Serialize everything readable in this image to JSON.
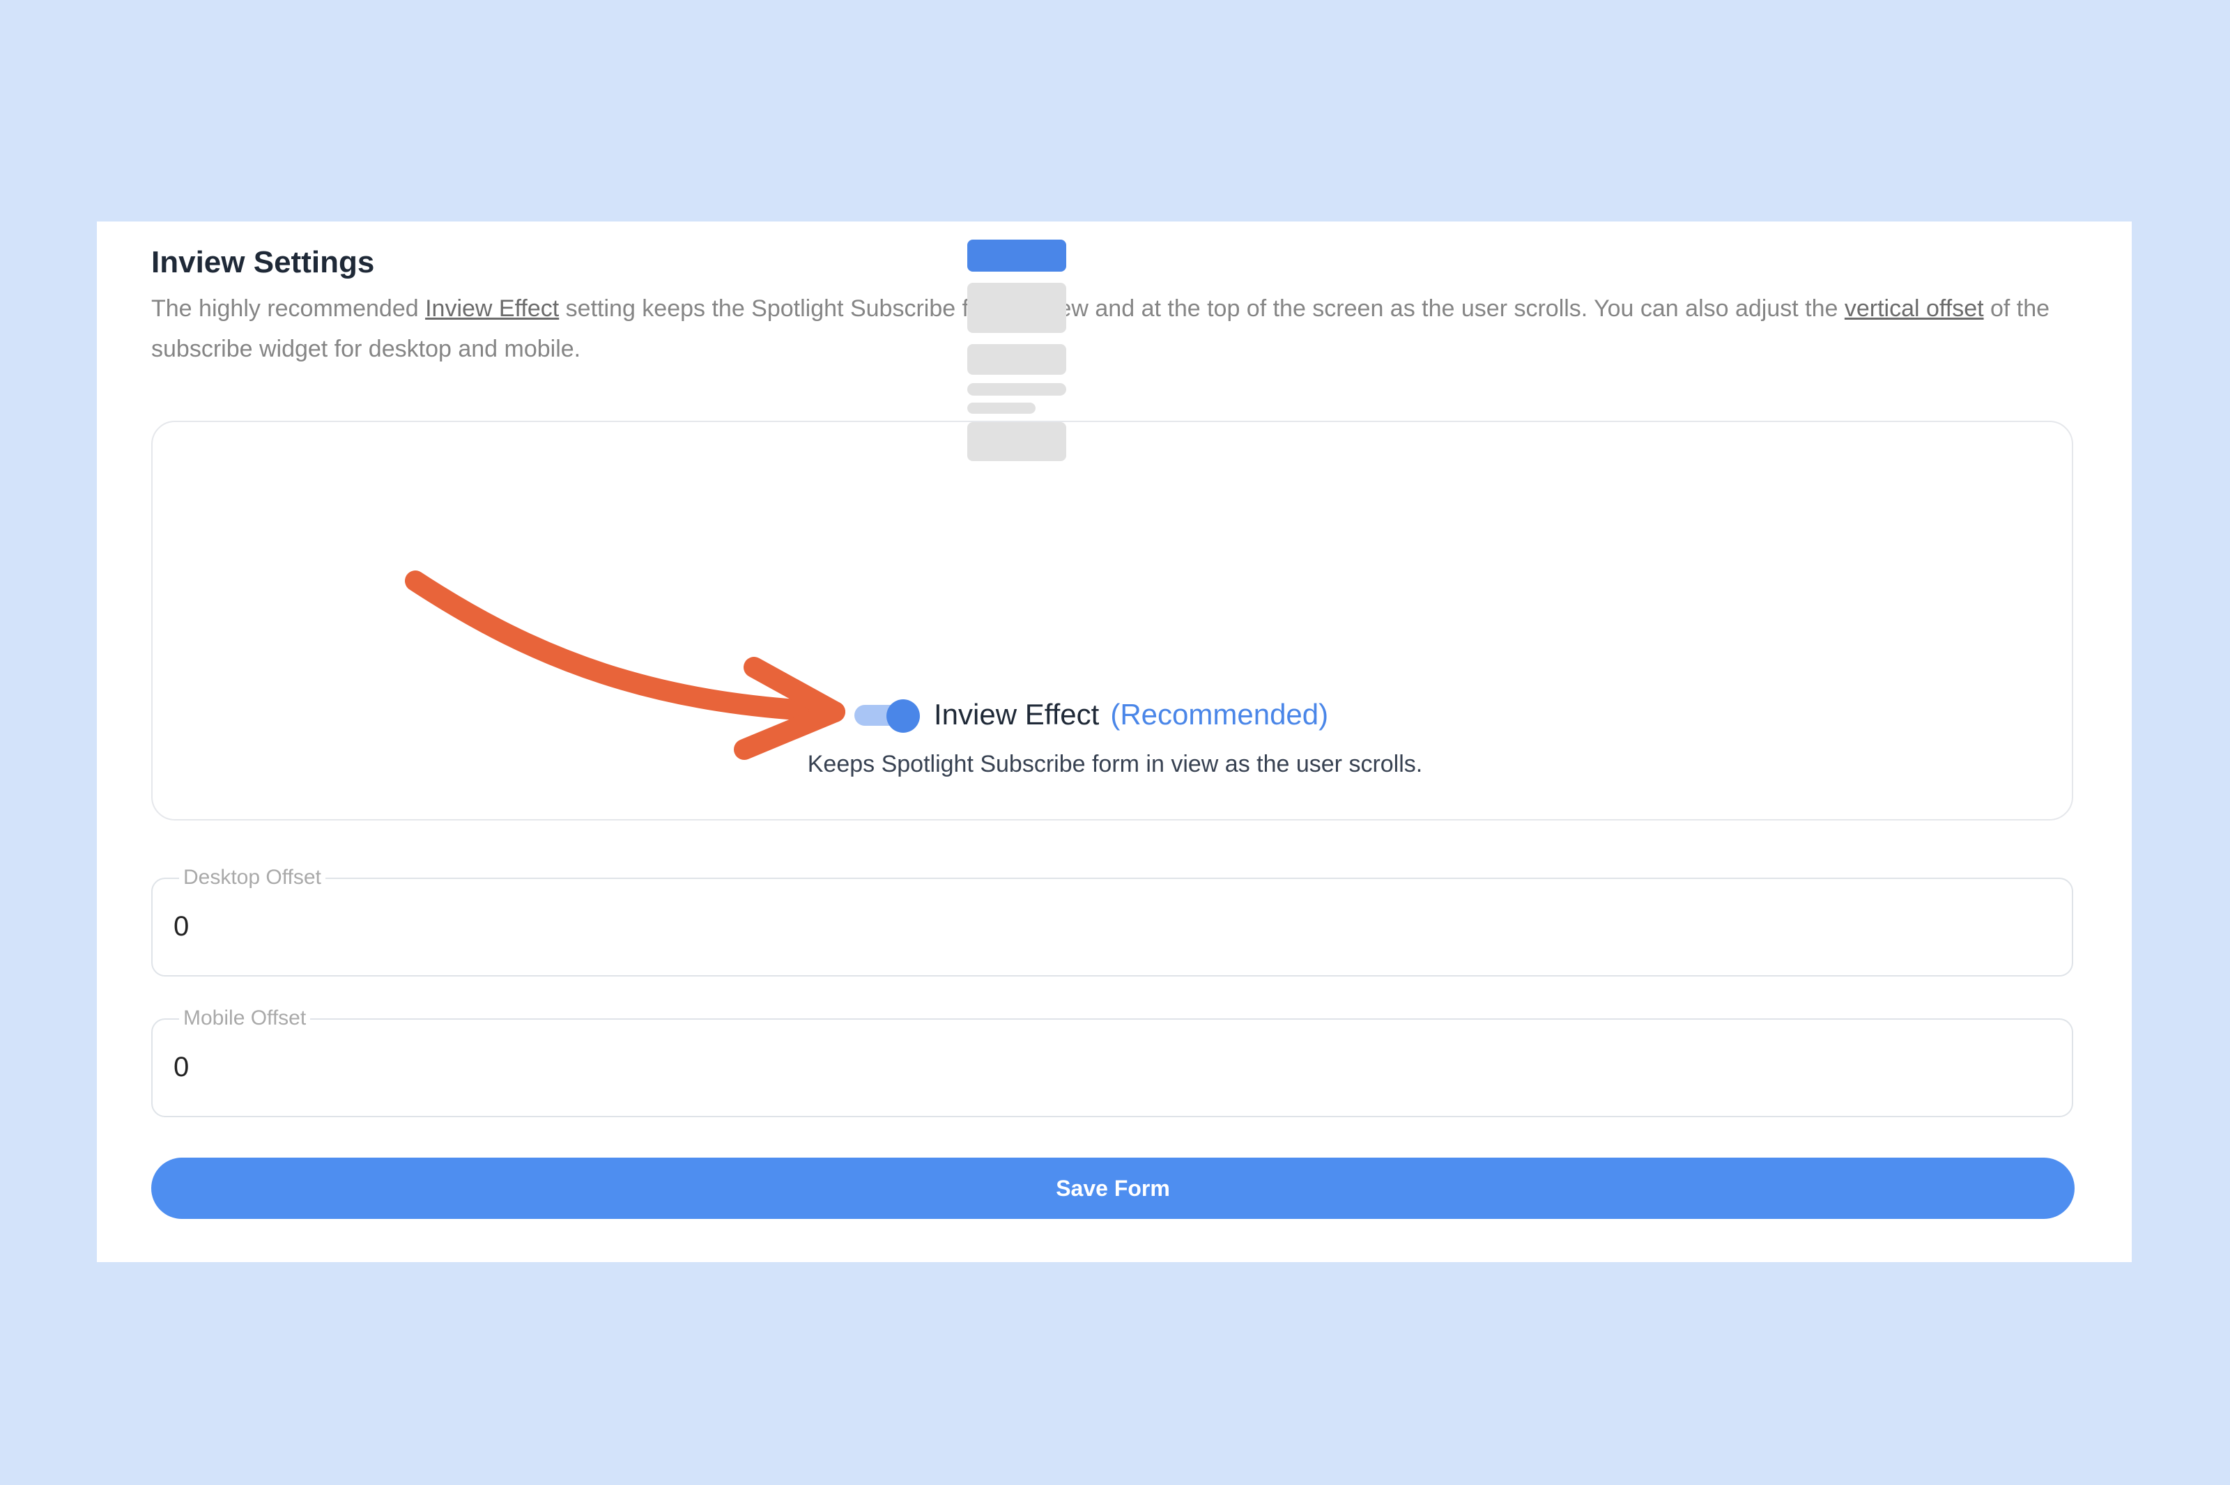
{
  "settings": {
    "title": "Inview Settings",
    "desc_part1": "The highly recommended ",
    "desc_link1": "Inview Effect",
    "desc_part2": " setting keeps the Spotlight Subscribe form in view and at the top of the screen as the user scrolls. You can also adjust the ",
    "desc_link2": "vertical offset",
    "desc_part3": " of the subscribe widget for desktop and mobile."
  },
  "inview": {
    "enabled": true,
    "label": "Inview Effect",
    "recommended": "(Recommended)",
    "description": "Keeps Spotlight Subscribe form in view as the user scrolls."
  },
  "fields": {
    "desktop_label": "Desktop Offset",
    "desktop_value": "0",
    "mobile_label": "Mobile Offset",
    "mobile_value": "0"
  },
  "actions": {
    "save_label": "Save Form"
  },
  "colors": {
    "page_background": "#d3e3fa",
    "accent": "#4e8ef0",
    "annotation_arrow": "#e8643a"
  }
}
